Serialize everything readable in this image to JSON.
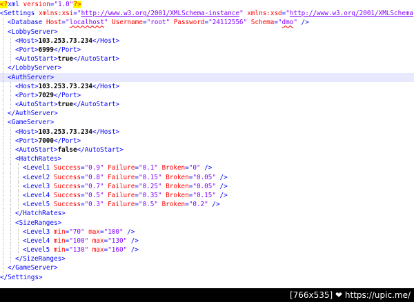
{
  "xml_lines": [
    {
      "indent": 0,
      "tokens": [
        {
          "t": "pi",
          "v": "<?"
        },
        {
          "t": "tag",
          "v": "xml "
        },
        {
          "t": "attr",
          "v": "version"
        },
        {
          "t": "tag",
          "v": "="
        },
        {
          "t": "val",
          "v": "\"1.0\""
        },
        {
          "t": "pi",
          "v": "?>"
        }
      ]
    },
    {
      "indent": 0,
      "tokens": [
        {
          "t": "tag",
          "v": "<Settings "
        },
        {
          "t": "attr",
          "v": "xmlns:xsi"
        },
        {
          "t": "tag",
          "v": "="
        },
        {
          "t": "val",
          "v": "\""
        },
        {
          "t": "url",
          "v": "http://www.w3.org/2001/XMLSchema-instance"
        },
        {
          "t": "val",
          "v": "\" "
        },
        {
          "t": "attr",
          "v": "xmlns:xsd"
        },
        {
          "t": "tag",
          "v": "="
        },
        {
          "t": "val",
          "v": "\""
        },
        {
          "t": "url",
          "v": "http://www.w3.org/2001/XMLSchema"
        },
        {
          "t": "val",
          "v": "\""
        },
        {
          "t": "tag",
          "v": ">"
        }
      ]
    },
    {
      "indent": 1,
      "tokens": [
        {
          "t": "tag",
          "v": "<Database "
        },
        {
          "t": "attr",
          "v": "Host"
        },
        {
          "t": "tag",
          "v": "="
        },
        {
          "t": "val",
          "v": "\""
        },
        {
          "t": "wavy",
          "v": "localhost"
        },
        {
          "t": "val",
          "v": "\" "
        },
        {
          "t": "attr",
          "v": "Username"
        },
        {
          "t": "tag",
          "v": "="
        },
        {
          "t": "val",
          "v": "\"root\" "
        },
        {
          "t": "attr",
          "v": "Password"
        },
        {
          "t": "tag",
          "v": "="
        },
        {
          "t": "val",
          "v": "\"24112556\" "
        },
        {
          "t": "attr",
          "v": "Schema"
        },
        {
          "t": "tag",
          "v": "="
        },
        {
          "t": "val",
          "v": "\""
        },
        {
          "t": "wavy",
          "v": "dmo"
        },
        {
          "t": "val",
          "v": "\" "
        },
        {
          "t": "tag",
          "v": "/>"
        }
      ]
    },
    {
      "indent": 1,
      "tokens": [
        {
          "t": "tag",
          "v": "<LobbyServer>"
        }
      ]
    },
    {
      "indent": 2,
      "tokens": [
        {
          "t": "tag",
          "v": "<Host>"
        },
        {
          "t": "txt",
          "v": "103.253.73.234"
        },
        {
          "t": "tag",
          "v": "</Host>"
        }
      ]
    },
    {
      "indent": 2,
      "tokens": [
        {
          "t": "tag",
          "v": "<Port>"
        },
        {
          "t": "txt",
          "v": "6999"
        },
        {
          "t": "tag",
          "v": "</Port>"
        }
      ]
    },
    {
      "indent": 2,
      "tokens": [
        {
          "t": "tag",
          "v": "<AutoStart>"
        },
        {
          "t": "txt",
          "v": "true"
        },
        {
          "t": "tag",
          "v": "</AutoStart>"
        }
      ]
    },
    {
      "indent": 1,
      "tokens": [
        {
          "t": "tag",
          "v": "</LobbyServer>"
        }
      ]
    },
    {
      "indent": 1,
      "highlight": true,
      "tokens": [
        {
          "t": "tag",
          "v": "<AuthServer>"
        }
      ]
    },
    {
      "indent": 2,
      "tokens": [
        {
          "t": "tag",
          "v": "<Host>"
        },
        {
          "t": "txt",
          "v": "103.253.73.234"
        },
        {
          "t": "tag",
          "v": "</Host>"
        }
      ]
    },
    {
      "indent": 2,
      "tokens": [
        {
          "t": "tag",
          "v": "<Port>"
        },
        {
          "t": "txt",
          "v": "7029"
        },
        {
          "t": "tag",
          "v": "</Port>"
        }
      ]
    },
    {
      "indent": 2,
      "tokens": [
        {
          "t": "tag",
          "v": "<AutoStart>"
        },
        {
          "t": "txt",
          "v": "true"
        },
        {
          "t": "tag",
          "v": "</AutoStart>"
        }
      ]
    },
    {
      "indent": 1,
      "tokens": [
        {
          "t": "tag",
          "v": "</AuthServer>"
        }
      ]
    },
    {
      "indent": 1,
      "tokens": [
        {
          "t": "tag",
          "v": "<GameServer>"
        }
      ]
    },
    {
      "indent": 2,
      "tokens": [
        {
          "t": "tag",
          "v": "<Host>"
        },
        {
          "t": "txt",
          "v": "103.253.73.234"
        },
        {
          "t": "tag",
          "v": "</Host>"
        }
      ]
    },
    {
      "indent": 2,
      "tokens": [
        {
          "t": "tag",
          "v": "<Port>"
        },
        {
          "t": "txt",
          "v": "7000"
        },
        {
          "t": "tag",
          "v": "</Port>"
        }
      ]
    },
    {
      "indent": 2,
      "tokens": [
        {
          "t": "tag",
          "v": "<AutoStart>"
        },
        {
          "t": "txt",
          "v": "false"
        },
        {
          "t": "tag",
          "v": "</AutoStart>"
        }
      ]
    },
    {
      "indent": 2,
      "tokens": [
        {
          "t": "tag",
          "v": "<HatchRates>"
        }
      ]
    },
    {
      "indent": 3,
      "tokens": [
        {
          "t": "tag",
          "v": "<Level1 "
        },
        {
          "t": "attr",
          "v": "Success"
        },
        {
          "t": "tag",
          "v": "="
        },
        {
          "t": "val",
          "v": "\"0.9\" "
        },
        {
          "t": "attr",
          "v": "Failure"
        },
        {
          "t": "tag",
          "v": "="
        },
        {
          "t": "val",
          "v": "\"0.1\" "
        },
        {
          "t": "attr",
          "v": "Broken"
        },
        {
          "t": "tag",
          "v": "="
        },
        {
          "t": "val",
          "v": "\"0\" "
        },
        {
          "t": "tag",
          "v": "/>"
        }
      ]
    },
    {
      "indent": 3,
      "tokens": [
        {
          "t": "tag",
          "v": "<Level2 "
        },
        {
          "t": "attr",
          "v": "Success"
        },
        {
          "t": "tag",
          "v": "="
        },
        {
          "t": "val",
          "v": "\"0.8\" "
        },
        {
          "t": "attr",
          "v": "Failure"
        },
        {
          "t": "tag",
          "v": "="
        },
        {
          "t": "val",
          "v": "\"0.15\" "
        },
        {
          "t": "attr",
          "v": "Broken"
        },
        {
          "t": "tag",
          "v": "="
        },
        {
          "t": "val",
          "v": "\"0.05\" "
        },
        {
          "t": "tag",
          "v": "/>"
        }
      ]
    },
    {
      "indent": 3,
      "tokens": [
        {
          "t": "tag",
          "v": "<Level3 "
        },
        {
          "t": "attr",
          "v": "Success"
        },
        {
          "t": "tag",
          "v": "="
        },
        {
          "t": "val",
          "v": "\"0.7\" "
        },
        {
          "t": "attr",
          "v": "Failure"
        },
        {
          "t": "tag",
          "v": "="
        },
        {
          "t": "val",
          "v": "\"0.25\" "
        },
        {
          "t": "attr",
          "v": "Broken"
        },
        {
          "t": "tag",
          "v": "="
        },
        {
          "t": "val",
          "v": "\"0.05\" "
        },
        {
          "t": "tag",
          "v": "/>"
        }
      ]
    },
    {
      "indent": 3,
      "tokens": [
        {
          "t": "tag",
          "v": "<Level4 "
        },
        {
          "t": "attr",
          "v": "Success"
        },
        {
          "t": "tag",
          "v": "="
        },
        {
          "t": "val",
          "v": "\"0.5\" "
        },
        {
          "t": "attr",
          "v": "Failure"
        },
        {
          "t": "tag",
          "v": "="
        },
        {
          "t": "val",
          "v": "\"0.35\" "
        },
        {
          "t": "attr",
          "v": "Broken"
        },
        {
          "t": "tag",
          "v": "="
        },
        {
          "t": "val",
          "v": "\"0.15\" "
        },
        {
          "t": "tag",
          "v": "/>"
        }
      ]
    },
    {
      "indent": 3,
      "tokens": [
        {
          "t": "tag",
          "v": "<Level5 "
        },
        {
          "t": "attr",
          "v": "Success"
        },
        {
          "t": "tag",
          "v": "="
        },
        {
          "t": "val",
          "v": "\"0.3\" "
        },
        {
          "t": "attr",
          "v": "Failure"
        },
        {
          "t": "tag",
          "v": "="
        },
        {
          "t": "val",
          "v": "\"0.5\" "
        },
        {
          "t": "attr",
          "v": "Broken"
        },
        {
          "t": "tag",
          "v": "="
        },
        {
          "t": "val",
          "v": "\"0.2\" "
        },
        {
          "t": "tag",
          "v": "/>"
        }
      ]
    },
    {
      "indent": 2,
      "tokens": [
        {
          "t": "tag",
          "v": "</HatchRates>"
        }
      ]
    },
    {
      "indent": 2,
      "tokens": [
        {
          "t": "tag",
          "v": "<SizeRanges>"
        }
      ]
    },
    {
      "indent": 3,
      "tokens": [
        {
          "t": "tag",
          "v": "<Level3 "
        },
        {
          "t": "attr",
          "v": "min"
        },
        {
          "t": "tag",
          "v": "="
        },
        {
          "t": "val",
          "v": "\"70\" "
        },
        {
          "t": "attr",
          "v": "max"
        },
        {
          "t": "tag",
          "v": "="
        },
        {
          "t": "val",
          "v": "\"100\" "
        },
        {
          "t": "tag",
          "v": "/>"
        }
      ]
    },
    {
      "indent": 3,
      "tokens": [
        {
          "t": "tag",
          "v": "<Level4 "
        },
        {
          "t": "attr",
          "v": "min"
        },
        {
          "t": "tag",
          "v": "="
        },
        {
          "t": "val",
          "v": "\"100\" "
        },
        {
          "t": "attr",
          "v": "max"
        },
        {
          "t": "tag",
          "v": "="
        },
        {
          "t": "val",
          "v": "\"130\" "
        },
        {
          "t": "tag",
          "v": "/>"
        }
      ]
    },
    {
      "indent": 3,
      "tokens": [
        {
          "t": "tag",
          "v": "<Level5 "
        },
        {
          "t": "attr",
          "v": "min"
        },
        {
          "t": "tag",
          "v": "="
        },
        {
          "t": "val",
          "v": "\"130\" "
        },
        {
          "t": "attr",
          "v": "max"
        },
        {
          "t": "tag",
          "v": "="
        },
        {
          "t": "val",
          "v": "\"160\" "
        },
        {
          "t": "tag",
          "v": "/>"
        }
      ]
    },
    {
      "indent": 2,
      "tokens": [
        {
          "t": "tag",
          "v": "</SizeRanges>"
        }
      ]
    },
    {
      "indent": 1,
      "tokens": [
        {
          "t": "tag",
          "v": "</GameServer>"
        }
      ]
    },
    {
      "indent": 0,
      "tokens": [
        {
          "t": "tag",
          "v": "</Settings>"
        }
      ]
    }
  ],
  "footer": {
    "watermark": "[766x535] ❤ https://upic.me/"
  }
}
